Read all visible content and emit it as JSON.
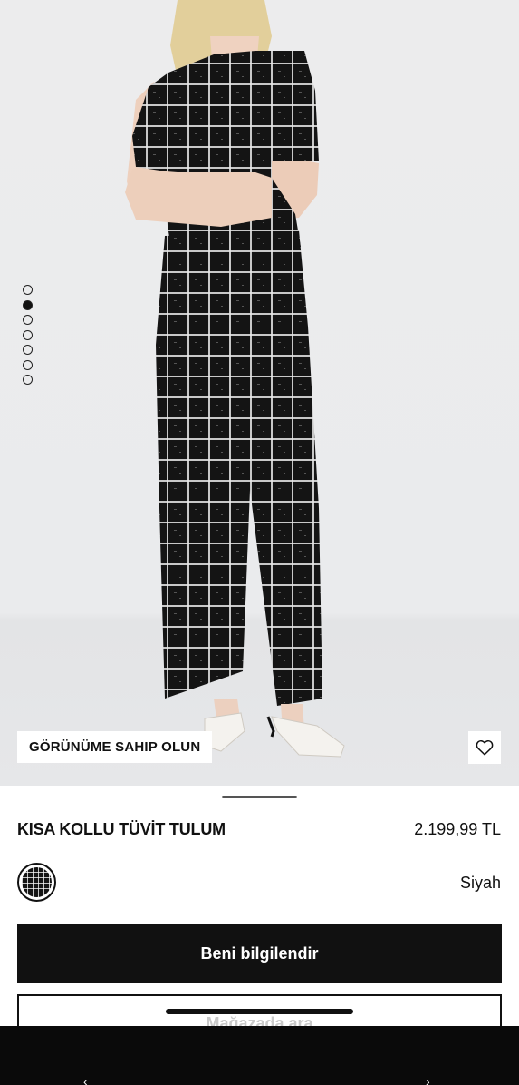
{
  "gallery": {
    "image_count": 7,
    "active_index": 1,
    "look_badge_label": "GÖRÜNÜME SAHIP OLUN",
    "favorite_icon": "heart-icon"
  },
  "product": {
    "title": "KISA KOLLU TÜVİT TULUM",
    "price": "2.199,99 TL",
    "color_name": "Siyah",
    "swatch_pattern": "black-white-tweed-check"
  },
  "actions": {
    "notify_label": "Beni bilgilendir",
    "store_label": "Mağazada ara"
  },
  "colors": {
    "primary": "#111111",
    "background": "#ffffff",
    "photo_background": "#eaebed"
  },
  "system": {
    "nav_back_icon": "chevron-left-icon",
    "nav_forward_icon": "chevron-right-icon"
  }
}
